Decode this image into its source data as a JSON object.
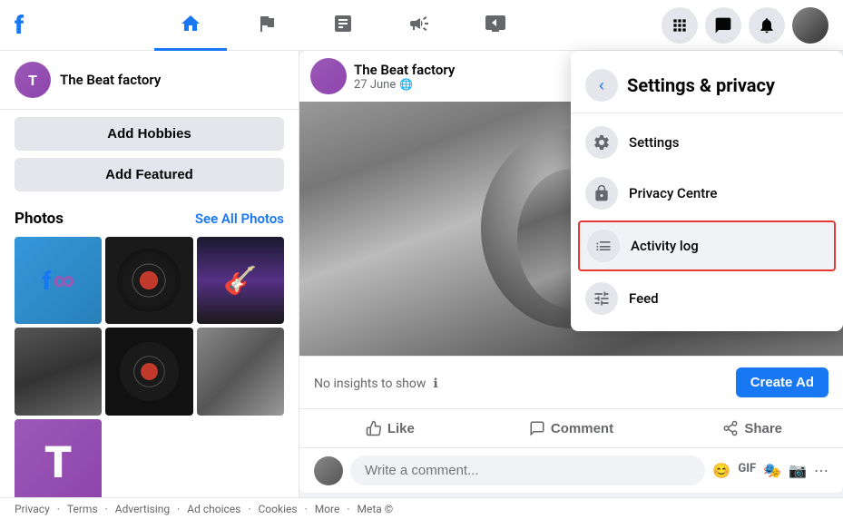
{
  "app": {
    "name": "Facebook"
  },
  "topnav": {
    "profile_name": "The Beat factory",
    "profile_initial": "T",
    "nav_icons": [
      "home",
      "flag",
      "chart",
      "megaphone",
      "play",
      "grid",
      "messenger",
      "bell",
      "profile"
    ]
  },
  "sidebar": {
    "profile_name": "The Beat factory",
    "profile_initial": "T",
    "add_hobbies_label": "Add Hobbies",
    "add_featured_label": "Add Featured",
    "photos_title": "Photos",
    "see_all_photos_label": "See All Photos"
  },
  "post": {
    "profile_name": "The Beat factory",
    "date": "27 June",
    "insights_text": "No insights to show",
    "create_ad_label": "Create Ad",
    "like_label": "Like",
    "comment_label": "Comment",
    "share_label": "Share",
    "comment_placeholder": "Write a comment..."
  },
  "settings_panel": {
    "title": "Settings & privacy",
    "back_label": "←",
    "items": [
      {
        "id": "settings",
        "label": "Settings",
        "icon": "gear"
      },
      {
        "id": "privacy-centre",
        "label": "Privacy Centre",
        "icon": "lock"
      },
      {
        "id": "activity-log",
        "label": "Activity log",
        "icon": "list",
        "highlighted": true
      },
      {
        "id": "feed",
        "label": "Feed",
        "icon": "sliders"
      }
    ]
  },
  "footer": {
    "links": [
      "Privacy",
      "Terms",
      "Advertising",
      "Ad choices",
      "Cookies",
      "More",
      "Meta ©"
    ]
  }
}
